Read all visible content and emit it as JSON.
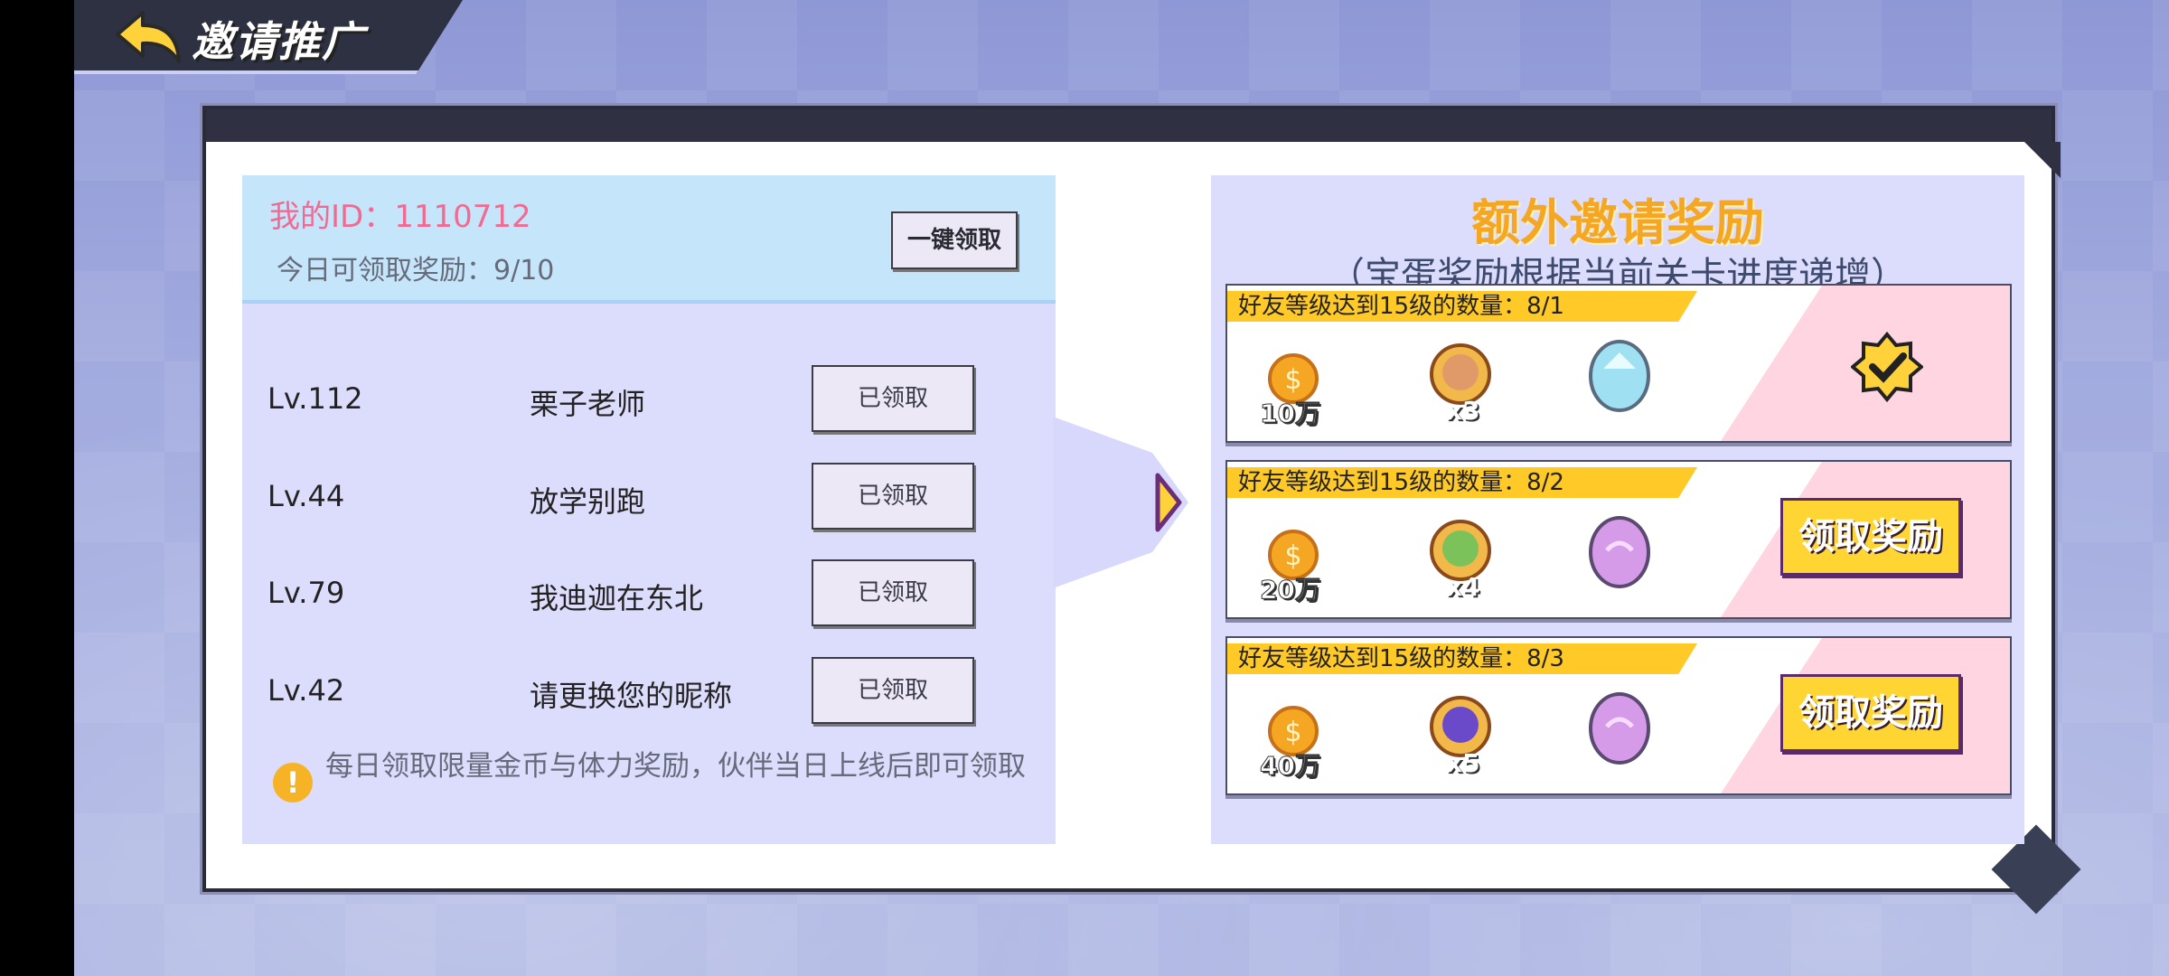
{
  "header": {
    "title": "邀请推广"
  },
  "left": {
    "my_id": "我的ID：1110712",
    "today_claimable": "今日可领取奖励：9/10",
    "claim_all_label": "一键领取",
    "friends": [
      {
        "level": "Lv.112",
        "name": "栗子老师",
        "status": "已领取"
      },
      {
        "level": "Lv.44",
        "name": "放学别跑",
        "status": "已领取"
      },
      {
        "level": "Lv.79",
        "name": "我迪迦在东北",
        "status": "已领取"
      },
      {
        "level": "Lv.42",
        "name": "请更换您的昵称",
        "status": "已领取"
      }
    ],
    "notice": "每日领取限量金币与体力奖励，伙伴当日上线后即可领取"
  },
  "right": {
    "title": "额外邀请奖励",
    "subtitle": "（宝蛋奖励根据当前关卡进度递增）",
    "rewards": [
      {
        "condition": "好友等级达到15级的数量：8/1",
        "coins": "10万",
        "hero_count": "x3",
        "egg": "blue-egg-icon",
        "state": "claimed"
      },
      {
        "condition": "好友等级达到15级的数量：8/2",
        "coins": "20万",
        "hero_count": "x4",
        "egg": "purple-egg-icon",
        "state": "claimable",
        "button": "领取奖励"
      },
      {
        "condition": "好友等级达到15级的数量：8/3",
        "coins": "40万",
        "hero_count": "x5",
        "egg": "purple-egg-icon",
        "state": "claimable",
        "button": "领取奖励"
      }
    ]
  },
  "colors": {
    "accent_orange": "#f5a623",
    "id_pink": "#f06a92",
    "tag_yellow": "#ffc928",
    "panel_lavender": "#dcdcfc"
  }
}
